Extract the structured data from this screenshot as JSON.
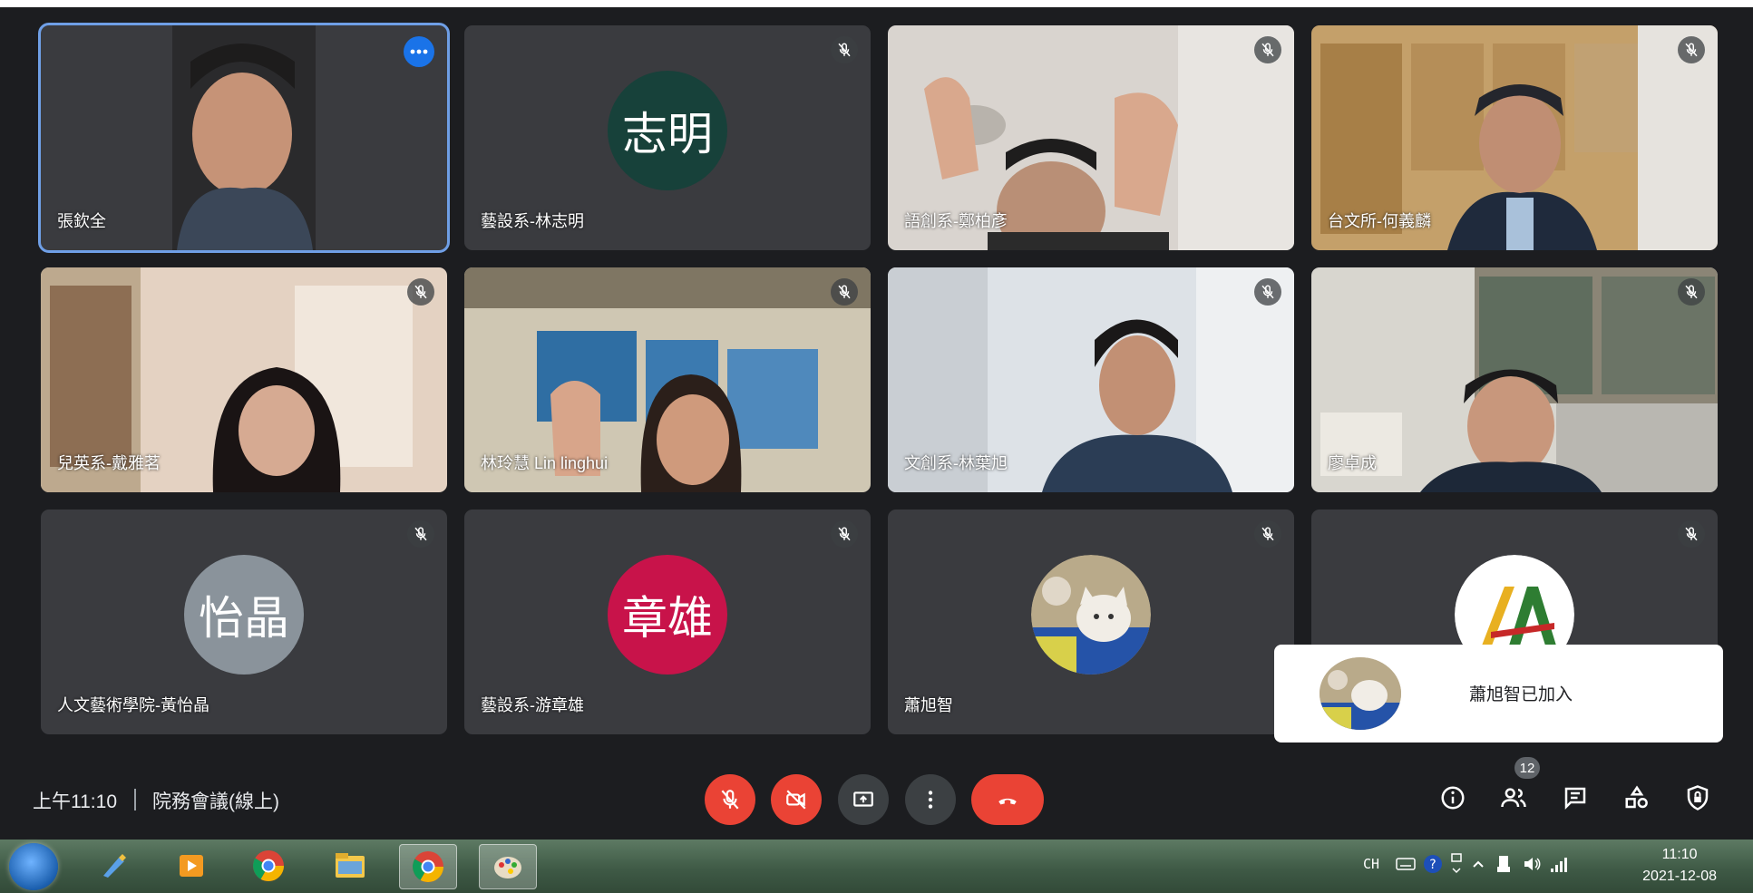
{
  "participants": [
    {
      "name": "張欽全",
      "type": "video",
      "active": true
    },
    {
      "name": "藝設系-林志明",
      "type": "avatar",
      "initials": "志明",
      "color": "#17413a"
    },
    {
      "name": "語創系-鄭柏彥",
      "type": "video"
    },
    {
      "name": "台文所-何義麟",
      "type": "video"
    },
    {
      "name": "兒英系-戴雅茗",
      "type": "video"
    },
    {
      "name": "林玲慧 Lin linghui",
      "type": "video"
    },
    {
      "name": "文創系-林葉旭",
      "type": "video"
    },
    {
      "name": "廖卓成",
      "type": "video"
    },
    {
      "name": "人文藝術學院-黃怡晶",
      "type": "avatar",
      "initials": "怡晶",
      "color": "#8a939b"
    },
    {
      "name": "藝設系-游章雄",
      "type": "avatar",
      "initials": "章雄",
      "color": "#c8134a"
    },
    {
      "name": "蕭旭智",
      "type": "photo"
    },
    {
      "name": "",
      "type": "logo"
    }
  ],
  "toast": {
    "message": "蕭旭智已加入"
  },
  "bottom": {
    "time": "上午11:10",
    "meeting_title": "院務會議(線上)",
    "participant_count": "12"
  },
  "taskbar": {
    "lang": "CH",
    "time": "11:10",
    "date": "2021-12-08"
  },
  "colors": {
    "background": "#1c1d20",
    "tile": "#3a3b3f",
    "active_outline": "#6f9fe6",
    "danger": "#ea4335"
  },
  "icons": [
    "mic-off-icon",
    "more-options-icon",
    "camera-off-icon",
    "present-screen-icon",
    "more-vert-icon",
    "end-call-icon",
    "info-icon",
    "people-icon",
    "chat-icon",
    "activities-icon",
    "host-controls-icon"
  ]
}
